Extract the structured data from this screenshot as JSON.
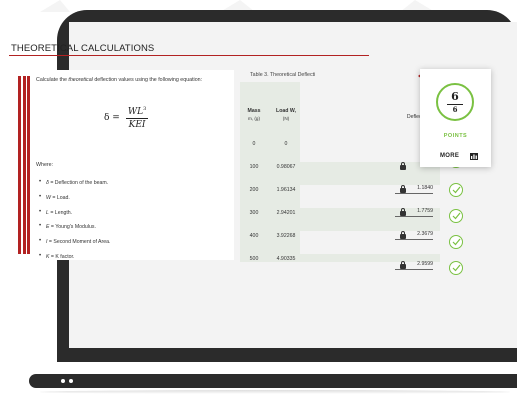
{
  "section": {
    "title": "THEORETICAL CALCULATIONS",
    "accent_color": "#b22222"
  },
  "instructions": {
    "intro_before": "Calculate the ",
    "intro_em": "theoretical",
    "intro_after": " deflection values using the following equation:",
    "formula_lhs": "δ =",
    "formula_num": "WL",
    "formula_num_exp": "3",
    "formula_den": "KEI",
    "where_label": "Where:",
    "definitions": [
      {
        "symbol": "δ",
        "text": " = Deflection of the beam."
      },
      {
        "symbol": "W",
        "text": " = Load."
      },
      {
        "symbol": "L",
        "text": " = Length."
      },
      {
        "symbol": "E",
        "text": " = Young's Modulus."
      },
      {
        "symbol": "I",
        "text": " = Second Moment of Area."
      },
      {
        "symbol": "K",
        "text": " = K factor."
      }
    ]
  },
  "table": {
    "caption": "Table 3. Theoretical Deflecti",
    "headers": {
      "mass": "Mass",
      "mass_unit": "m, (g)",
      "load": "Load W,",
      "load_unit": "(N)",
      "deflection": "Deflect"
    },
    "rows": [
      {
        "mass": "0",
        "load": "0",
        "deflection": ""
      },
      {
        "mass": "100",
        "load": "0.98067",
        "deflection": ""
      },
      {
        "mass": "200",
        "load": "1.96134",
        "deflection": "1.1840"
      },
      {
        "mass": "300",
        "load": "2.94201",
        "deflection": "1.7759"
      },
      {
        "mass": "400",
        "load": "3.92268",
        "deflection": "2.3679"
      },
      {
        "mass": "500",
        "load": "4.90335",
        "deflection": "2.9599"
      }
    ],
    "check_color": "#7ac142"
  },
  "score": {
    "earned": "6",
    "total": "6",
    "label": "POINTS",
    "more_label": "MORE"
  }
}
